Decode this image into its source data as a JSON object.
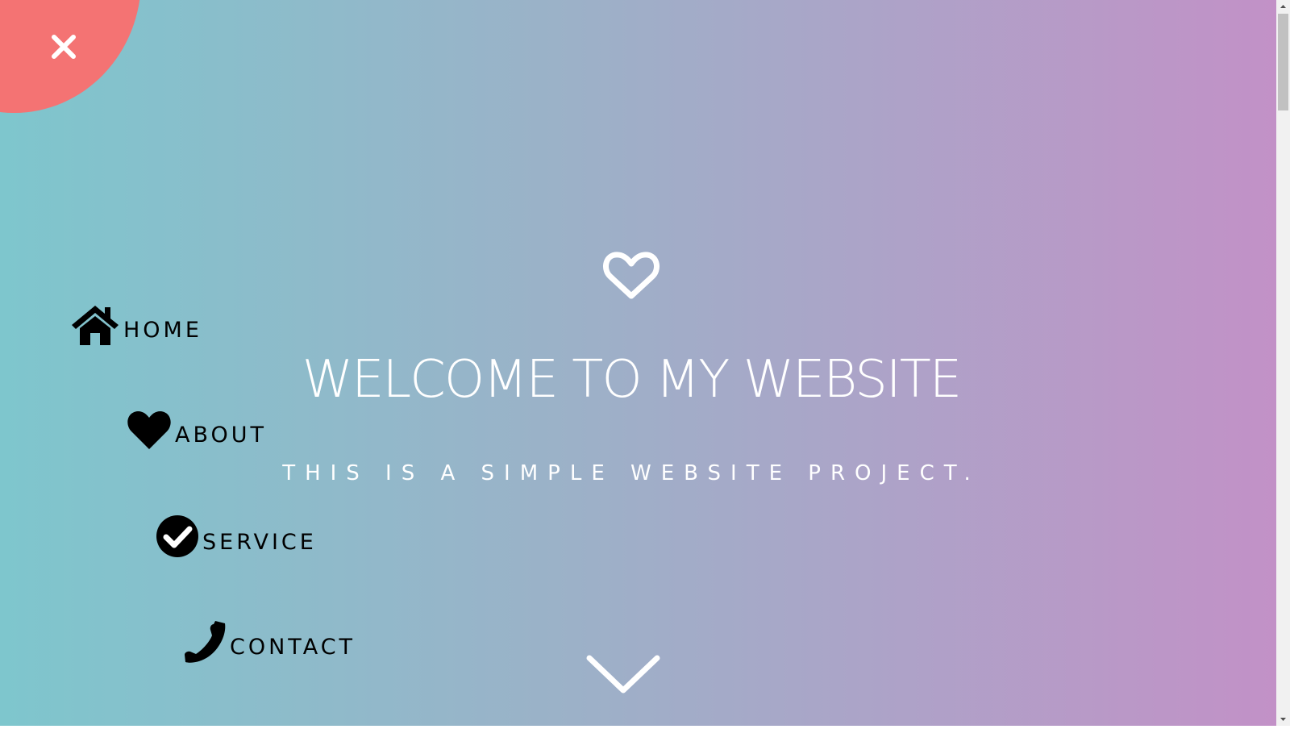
{
  "nav": {
    "close_icon": "close-icon",
    "items": [
      {
        "label": "HOME",
        "icon": "home-icon"
      },
      {
        "label": "ABOUT",
        "icon": "heart-icon"
      },
      {
        "label": "SERVICE",
        "icon": "check-circle-icon"
      },
      {
        "label": "CONTACT",
        "icon": "phone-icon"
      }
    ]
  },
  "hero": {
    "icon": "heart-outline-icon",
    "title": "WELCOME TO MY WEBSITE",
    "subtitle": "THIS IS A SIMPLE WEBSITE PROJECT.",
    "scroll_icon": "chevron-down-icon"
  },
  "colors": {
    "gradient_start": "#7ec6cd",
    "gradient_end": "#c291c7",
    "menu_blob": "#f47373",
    "text_light": "#ffffff",
    "nav_text": "#000000"
  }
}
